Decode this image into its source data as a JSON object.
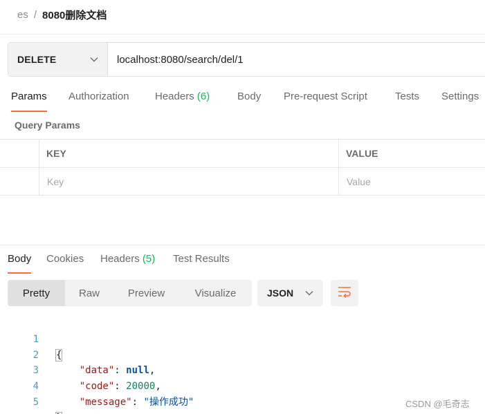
{
  "breadcrumb": {
    "parent": "es",
    "separator": "/",
    "current": "8080删除文档"
  },
  "request": {
    "method": "DELETE",
    "url": "localhost:8080/search/del/1"
  },
  "request_tabs": {
    "params": "Params",
    "authorization": "Authorization",
    "headers": "Headers",
    "headers_count": "(6)",
    "body": "Body",
    "prerequest": "Pre-request Script",
    "tests": "Tests",
    "settings": "Settings"
  },
  "query_params": {
    "title": "Query Params",
    "columns": {
      "key": "KEY",
      "value": "VALUE"
    },
    "placeholders": {
      "key": "Key",
      "value": "Value"
    }
  },
  "response_tabs": {
    "body": "Body",
    "cookies": "Cookies",
    "headers": "Headers",
    "headers_count": "(5)",
    "test_results": "Test Results"
  },
  "view_modes": {
    "pretty": "Pretty",
    "raw": "Raw",
    "preview": "Preview",
    "visualize": "Visualize"
  },
  "format": "JSON",
  "response_body": {
    "line_numbers": [
      "1",
      "2",
      "3",
      "4",
      "5"
    ],
    "open_brace": "{",
    "close_brace": "}",
    "data_key": "\"data\"",
    "data_value": "null",
    "code_key": "\"code\"",
    "code_value": "20000",
    "message_key": "\"message\"",
    "message_value": "\"操作成功\"",
    "colon": ": ",
    "comma": ","
  },
  "watermark": "CSDN @毛奇志",
  "colors": {
    "accent": "#ff6c37",
    "count_green": "#0cbb52",
    "line_number": "#4a9bc4"
  }
}
